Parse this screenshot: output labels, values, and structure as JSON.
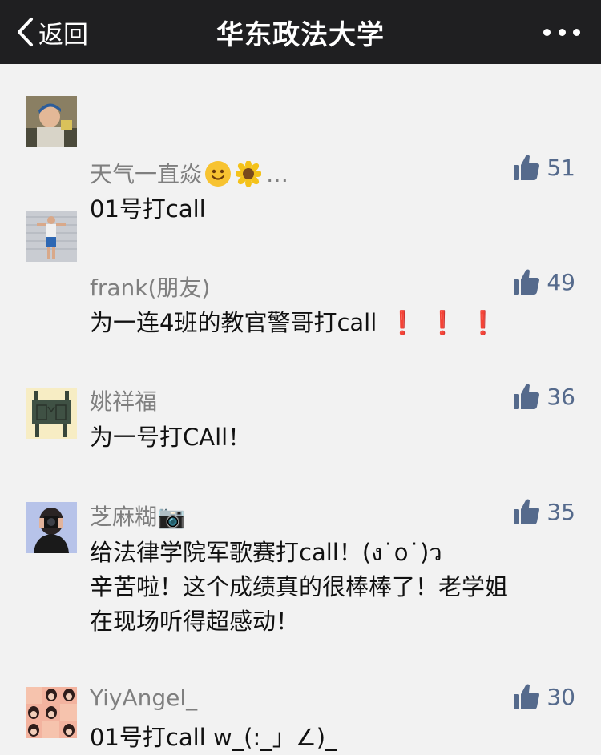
{
  "nav": {
    "back_label": "返回",
    "title": "华东政法大学"
  },
  "comments": [
    {
      "name": "天气一直焱",
      "name_suffix": "…",
      "text": "01号打call",
      "likes": "51",
      "avatar": "avatar-child-photo"
    },
    {
      "name": "frank(朋友)",
      "text": "为一连4班的教官警哥打call",
      "bangs": [
        "❗",
        "❗",
        "❗"
      ],
      "likes": "49",
      "avatar": "avatar-person-photo"
    },
    {
      "name": "姚祥福",
      "text": "为一号打CAll！",
      "likes": "36",
      "avatar": "avatar-bronze-vessel"
    },
    {
      "name": "芝麻糊📷",
      "text": "给法律学院军歌赛打call！(ง˙o˙)ว\n辛苦啦！这个成绩真的很棒棒了！老学姐\n在现场听得超感动！",
      "likes": "35",
      "avatar": "avatar-camera-girl"
    },
    {
      "name": "YiyAngel_",
      "text": "01号打call w_(:_」∠)_",
      "likes": "30",
      "avatar": "avatar-girl-collage"
    }
  ],
  "colors": {
    "navbar": "#1f1f21",
    "background": "#f2f2f2",
    "like_accent": "#556a8c",
    "name": "#7f7f7f"
  }
}
